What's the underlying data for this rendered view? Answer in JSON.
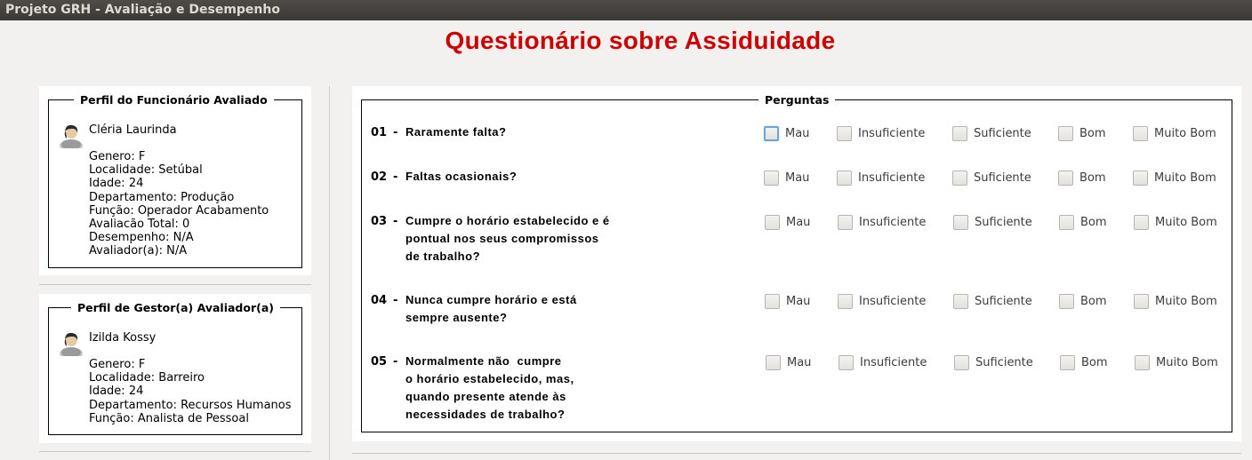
{
  "window": {
    "title": "Projeto GRH - Avaliação e Desempenho"
  },
  "page": {
    "title": "Questionário sobre Assiduidade"
  },
  "employee_profile": {
    "legend": "Perfil do Funcionário Avaliado",
    "avatar_icon": "person-avatar-icon",
    "name": "Cléria Laurinda",
    "details": [
      "Genero: F",
      "Localidade: Setúbal",
      "Idade: 24",
      "Departamento: Produção",
      "Função: Operador Acabamento",
      "Avaliacão Total: 0",
      "Desempenho: N/A",
      "Avaliador(a): N/A"
    ]
  },
  "manager_profile": {
    "legend": "Perfil de Gestor(a) Avaliador(a)",
    "avatar_icon": "person-avatar-icon",
    "name": "Izilda Kossy",
    "details": [
      "Genero: F",
      "Localidade: Barreiro",
      "Idade: 24",
      "Departamento: Recursos Humanos",
      "Função: Analista de Pessoal"
    ]
  },
  "questions_section": {
    "legend": "Perguntas",
    "separator": "-",
    "options": [
      "Mau",
      "Insuficiente",
      "Suficiente",
      "Bom",
      "Muito Bom"
    ],
    "questions": [
      {
        "number": "01",
        "lines": [
          "Raramente falta?"
        ],
        "checked": [
          false,
          false,
          false,
          false,
          false
        ]
      },
      {
        "number": "02",
        "lines": [
          "Faltas ocasionais?"
        ],
        "checked": [
          false,
          false,
          false,
          false,
          false
        ]
      },
      {
        "number": "03",
        "lines": [
          "Cumpre o horário estabelecido e é",
          "pontual nos seus compromissos",
          "de trabalho?"
        ],
        "checked": [
          false,
          false,
          false,
          false,
          false
        ]
      },
      {
        "number": "04",
        "lines": [
          "Nunca cumpre horário e está",
          "sempre ausente?"
        ],
        "checked": [
          false,
          false,
          false,
          false,
          false
        ]
      },
      {
        "number": "05",
        "lines": [
          "Normalmente não  cumpre",
          "o horário estabelecido, mas,",
          "quando presente atende às",
          "necessidades de trabalho?"
        ],
        "checked": [
          false,
          false,
          false,
          false,
          false
        ]
      }
    ]
  },
  "colors": {
    "title": "#cc0000",
    "focus_ring": "#6aa4d9"
  }
}
